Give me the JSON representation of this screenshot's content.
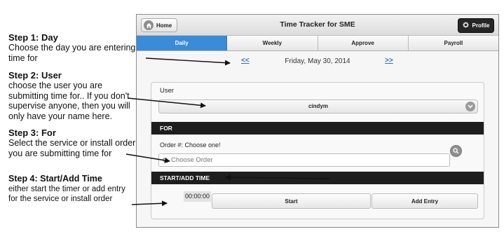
{
  "instructions": {
    "step1": {
      "title": "Step 1: Day",
      "body": "Choose the day you are entering time for"
    },
    "step2": {
      "title": "Step 2: User",
      "body": "choose the user you are submitting time for.. If you don't supervise anyone, then you will only have your name here."
    },
    "step3": {
      "title": "Step 3: For",
      "body": "Select the service or install order you are submitting time for"
    },
    "step4": {
      "title": "Step 4: Start/Add Time",
      "body": "either start the timer or add entry for the service or install order"
    }
  },
  "app": {
    "title": "Time Tracker for SME",
    "home_label": "Home",
    "profile_label": "Profile",
    "tabs": [
      {
        "label": "Daily",
        "active": true
      },
      {
        "label": "Weekly",
        "active": false
      },
      {
        "label": "Approve",
        "active": false
      },
      {
        "label": "Payroll",
        "active": false
      }
    ],
    "date_nav": {
      "prev": "<<",
      "date": "Friday, May 30, 2014",
      "next": ">>"
    },
    "user": {
      "label": "User",
      "selected": "cindym"
    },
    "for_section": {
      "header": "FOR",
      "order_label": "Order #: Choose one!",
      "order_placeholder": "Choose Order"
    },
    "start_section": {
      "header": "START/ADD TIME",
      "timer": "00:00:00",
      "start_label": "Start",
      "add_entry_label": "Add Entry"
    }
  },
  "icons": {
    "home": "home-icon",
    "profile": "gear-icon",
    "select_arrow": "chevron-down-icon",
    "search": "search-icon",
    "arrow": "arrow-right-icon"
  },
  "colors": {
    "active_tab": "#3a8bd8",
    "section_bar": "#1e1e1e",
    "link": "#2a6fd0"
  }
}
